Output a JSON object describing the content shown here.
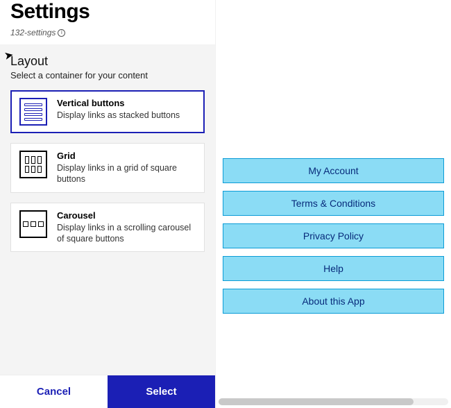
{
  "header": {
    "title": "Settings",
    "meta": "132-settings"
  },
  "layout": {
    "section_title": "Layout",
    "section_sub": "Select a container for your content",
    "options": [
      {
        "title": "Vertical buttons",
        "desc": "Display links as stacked buttons"
      },
      {
        "title": "Grid",
        "desc": "Display links in a grid of square buttons"
      },
      {
        "title": "Carousel",
        "desc": "Display links in a scrolling carousel of square buttons"
      }
    ],
    "selected_index": 0
  },
  "footer": {
    "cancel": "Cancel",
    "select": "Select"
  },
  "preview": {
    "buttons": [
      "My Account",
      "Terms & Conditions",
      "Privacy Policy",
      "Help",
      "About this App"
    ]
  },
  "icons": {
    "info": "i"
  }
}
